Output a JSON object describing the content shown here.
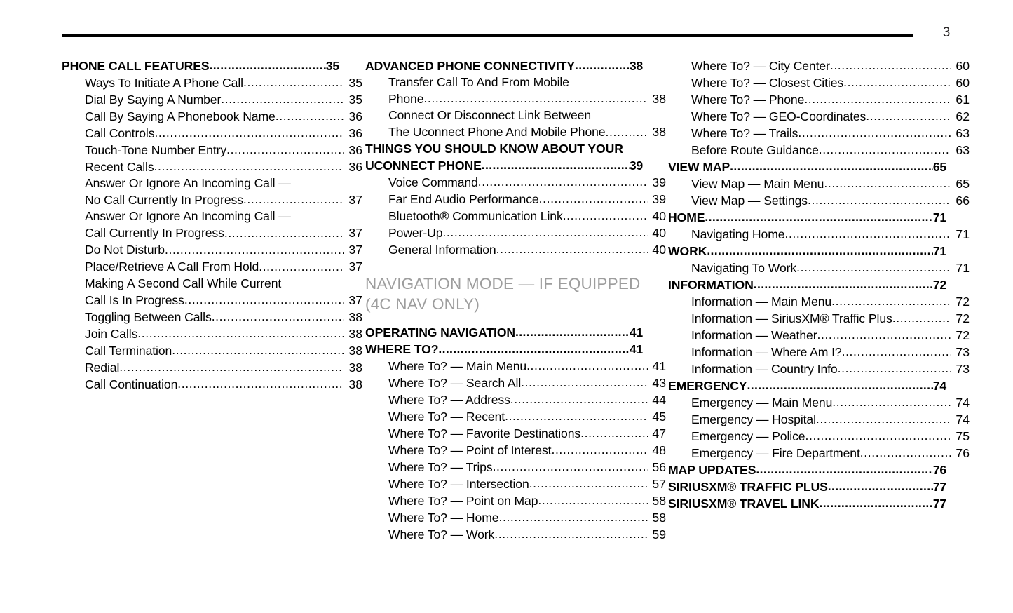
{
  "page": {
    "number": "3",
    "rule_color": "#000000",
    "section_header_color": "#9d9d9d"
  },
  "columns": [
    {
      "name": "column-1",
      "entries": [
        {
          "level": "main",
          "label": "PHONE CALL FEATURES",
          "page": "35"
        },
        {
          "level": "sub",
          "label": "Ways To Initiate A Phone Call ",
          "page": "35"
        },
        {
          "level": "sub",
          "label": "Dial By Saying A Number",
          "page": "35"
        },
        {
          "level": "sub",
          "label": "Call By Saying A Phonebook Name ",
          "page": "36"
        },
        {
          "level": "sub",
          "label": "Call Controls",
          "page": "36"
        },
        {
          "level": "sub",
          "label": "Touch-Tone Number Entry",
          "page": "36"
        },
        {
          "level": "sub",
          "label": "Recent Calls ",
          "page": "36"
        },
        {
          "level": "sub",
          "label": "Answer Or Ignore An Incoming Call —",
          "page": "",
          "nodots": true
        },
        {
          "level": "sub",
          "label": "No Call Currently In Progress ",
          "page": "37"
        },
        {
          "level": "sub",
          "label": "Answer Or Ignore An Incoming Call —",
          "page": "",
          "nodots": true
        },
        {
          "level": "sub",
          "label": "Call Currently In Progress",
          "page": "37"
        },
        {
          "level": "sub",
          "label": "Do Not Disturb  ",
          "page": "37"
        },
        {
          "level": "sub",
          "label": "Place/Retrieve A Call From Hold ",
          "page": "37"
        },
        {
          "level": "sub",
          "label": "Making A Second Call While Current",
          "page": "",
          "nodots": true
        },
        {
          "level": "sub",
          "label": "Call Is In Progress ",
          "page": "37"
        },
        {
          "level": "sub",
          "label": "Toggling Between Calls ",
          "page": "38"
        },
        {
          "level": "sub",
          "label": "Join Calls ",
          "page": "38"
        },
        {
          "level": "sub",
          "label": "Call Termination",
          "page": "38"
        },
        {
          "level": "sub",
          "label": "Redial",
          "page": "38"
        },
        {
          "level": "sub",
          "label": "Call Continuation ",
          "page": "38"
        }
      ]
    },
    {
      "name": "column-2",
      "entries": [
        {
          "level": "main",
          "label": "ADVANCED PHONE CONNECTIVITY  ",
          "page": "38"
        },
        {
          "level": "sub",
          "label": "Transfer Call To And From Mobile",
          "page": "",
          "nodots": true
        },
        {
          "level": "sub",
          "label": "Phone ",
          "page": "38"
        },
        {
          "level": "sub",
          "label": "Connect Or Disconnect Link Between",
          "page": "",
          "nodots": true
        },
        {
          "level": "sub",
          "label": "The Uconnect Phone And Mobile Phone",
          "page": "38"
        },
        {
          "level": "main",
          "label": "THINGS YOU SHOULD KNOW ABOUT YOUR",
          "page": "",
          "nodots": true
        },
        {
          "level": "main",
          "label": "UCONNECT PHONE",
          "page": "39"
        },
        {
          "level": "sub",
          "label": "Voice Command",
          "page": "39"
        },
        {
          "level": "sub",
          "label": "Far End Audio Performance",
          "page": "39"
        },
        {
          "level": "sub",
          "label": "Bluetooth® Communication Link",
          "page": "40"
        },
        {
          "level": "sub",
          "label": "Power-Up ",
          "page": "40"
        },
        {
          "level": "sub",
          "label": "General Information ",
          "page": "40"
        },
        {
          "type": "section",
          "lines": [
            "NAVIGATION MODE — IF EQUIPPED",
            "(4C NAV ONLY)"
          ]
        },
        {
          "level": "main",
          "label": "OPERATING NAVIGATION ",
          "page": "41"
        },
        {
          "level": "main",
          "label": "WHERE TO? ",
          "page": "41"
        },
        {
          "level": "sub",
          "label": "Where To? — Main Menu  ",
          "page": "41"
        },
        {
          "level": "sub",
          "label": "Where To? — Search All",
          "page": "43"
        },
        {
          "level": "sub",
          "label": "Where To? — Address  ",
          "page": "44"
        },
        {
          "level": "sub",
          "label": "Where To? — Recent  ",
          "page": "45"
        },
        {
          "level": "sub",
          "label": "Where To? — Favorite Destinations  ",
          "page": "47"
        },
        {
          "level": "sub",
          "label": "Where To? — Point of Interest ",
          "page": "48"
        },
        {
          "level": "sub",
          "label": "Where To? — Trips   ",
          "page": "56"
        },
        {
          "level": "sub",
          "label": "Where To? — Intersection   ",
          "page": "57"
        },
        {
          "level": "sub",
          "label": "Where To? — Point on Map  ",
          "page": "58"
        },
        {
          "level": "sub",
          "label": "Where To? — Home   ",
          "page": "58"
        },
        {
          "level": "sub",
          "label": "Where To? — Work",
          "page": "59"
        }
      ]
    },
    {
      "name": "column-3",
      "entries": [
        {
          "level": "sub",
          "label": "Where To? — City Center  ",
          "page": "60"
        },
        {
          "level": "sub",
          "label": "Where To? — Closest Cities ",
          "page": "60"
        },
        {
          "level": "sub",
          "label": "Where To? — Phone ",
          "page": "61"
        },
        {
          "level": "sub",
          "label": "Where To? — GEO-Coordinates  ",
          "page": "62"
        },
        {
          "level": "sub",
          "label": "Where To? — Trails  ",
          "page": "63"
        },
        {
          "level": "sub",
          "label": "Before Route Guidance ",
          "page": "63"
        },
        {
          "level": "main",
          "label": "VIEW MAP ",
          "page": "65"
        },
        {
          "level": "sub",
          "label": "View Map — Main Menu ",
          "page": "65"
        },
        {
          "level": "sub",
          "label": "View Map — Settings  ",
          "page": "66"
        },
        {
          "level": "main",
          "label": "HOME  ",
          "page": "71"
        },
        {
          "level": "sub",
          "label": "Navigating Home ",
          "page": "71"
        },
        {
          "level": "main",
          "label": "WORK ",
          "page": "71"
        },
        {
          "level": "sub",
          "label": "Navigating To Work ",
          "page": "71"
        },
        {
          "level": "main",
          "label": "INFORMATION ",
          "page": "72"
        },
        {
          "level": "sub",
          "label": "Information — Main Menu",
          "page": "72"
        },
        {
          "level": "sub",
          "label": "Information — SiriusXM® Traffic Plus ",
          "page": "72"
        },
        {
          "level": "sub",
          "label": "Information — Weather ",
          "page": "72"
        },
        {
          "level": "sub",
          "label": "Information — Where Am I? ",
          "page": "73"
        },
        {
          "level": "sub",
          "label": "Information — Country Info ",
          "page": "73"
        },
        {
          "level": "main",
          "label": "EMERGENCY ",
          "page": "74"
        },
        {
          "level": "sub",
          "label": "Emergency — Main Menu",
          "page": "74"
        },
        {
          "level": "sub",
          "label": "Emergency — Hospital",
          "page": "74"
        },
        {
          "level": "sub",
          "label": "Emergency — Police",
          "page": "75"
        },
        {
          "level": "sub",
          "label": "Emergency — Fire Department ",
          "page": "76"
        },
        {
          "level": "main",
          "label": "MAP UPDATES",
          "page": "76"
        },
        {
          "level": "main",
          "label": "SIRIUSXM® TRAFFIC PLUS ",
          "page": "77"
        },
        {
          "level": "main",
          "label": "SIRIUSXM® TRAVEL LINK ",
          "page": "77"
        }
      ]
    }
  ]
}
